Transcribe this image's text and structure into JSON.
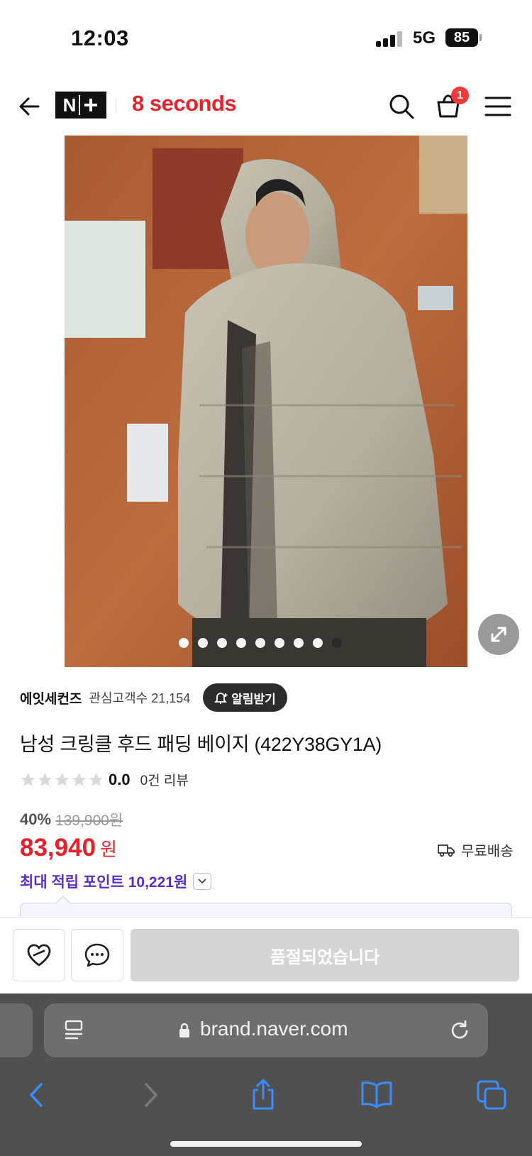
{
  "status_bar": {
    "time": "12:03",
    "network": "5G",
    "battery": "85"
  },
  "header": {
    "nplus_label": "N",
    "brand_title": "8 seconds",
    "cart_count": "1"
  },
  "gallery": {
    "slide_count": 9,
    "active_index": 8
  },
  "product": {
    "brand": "에잇세컨즈",
    "followers": "관심고객수 21,154",
    "notify_label": "알림받기",
    "title": "남성 크링클 후드 패딩 베이지 (422Y38GY1A)",
    "rating_value": "0.0",
    "rating_stars": 0,
    "review_count": "0건 리뷰",
    "discount": "40%",
    "original_price": "139,900원",
    "price": "83,940",
    "currency": "원",
    "shipping": "무료배송",
    "points": "최대 적립 포인트 10,221원"
  },
  "bottom_bar": {
    "soldout_label": "품절되었습니다"
  },
  "browser": {
    "url": "brand.naver.com"
  },
  "colors": {
    "accent_red": "#e8202a",
    "points_purple": "#5a2fc7",
    "safari_bg": "#505050"
  }
}
